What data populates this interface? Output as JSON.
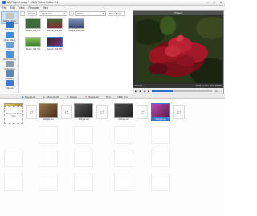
{
  "window": {
    "title": "MyProject.avspr* - AVS Video Editor 6.1",
    "minimize": "–",
    "maximize": "□",
    "close": "✕"
  },
  "menu": [
    "File",
    "Edit",
    "View",
    "Recorder",
    "Help"
  ],
  "sidebar": {
    "items": [
      {
        "label": "Media Library",
        "icon": "media-library-icon",
        "color": "#c4c4c4"
      },
      {
        "label": "Transitions",
        "icon": "transitions-icon",
        "color": "#2f73c4"
      },
      {
        "label": "Video Effects",
        "icon": "video-effects-icon",
        "color": "#3b8fd7"
      },
      {
        "label": "Text",
        "icon": "text-icon",
        "color": "#6a9fd9"
      },
      {
        "label": "Video Overlay",
        "icon": "video-overlay-icon",
        "color": "#4a90d8"
      },
      {
        "label": "Audio Mixer",
        "icon": "audio-mixer-icon",
        "color": "#8b9bb0"
      },
      {
        "label": "Chapters",
        "icon": "chapters-icon",
        "color": "#5d86b7"
      },
      {
        "label": "Produce",
        "icon": "produce-icon",
        "color": "#3a7ad2"
      }
    ]
  },
  "toolbar": {
    "import_label": "Import",
    "folder_value": "Clipboard",
    "filter_value": "Video",
    "save_label": "Save Movie..."
  },
  "library": {
    "items": [
      {
        "caption": "Sample_002_001",
        "color": "#3d6b3a"
      },
      {
        "caption": "Sample_002_002",
        "color": "#7b3b4a"
      },
      {
        "caption": "Sample_002_003",
        "color": "#4b5e8a"
      },
      {
        "caption": "Sample_002_004",
        "color": "#5a8a3a"
      },
      {
        "caption": "Sample_002_005",
        "color": "#6a2a5a"
      }
    ]
  },
  "preview": {
    "title": "Project",
    "status_left": "Paused",
    "status_right": "00:00:11.375 / 00:00:33.366",
    "progress": 0.35,
    "speed": "1x"
  },
  "edit_toolbar": {
    "items": [
      "Move Left",
      "Move Right",
      "Delete",
      "Delete all",
      "Trim",
      "Multi Trim"
    ]
  },
  "storyboard": {
    "drop_hint": "Drag media items here",
    "clips": [
      {
        "caption": "Sample.avi",
        "color": "#c9a93a"
      },
      {
        "caption": "Sample.avi",
        "color": "#6a4a2a"
      },
      {
        "caption": "Sample.avi",
        "color": "#3a3a3a"
      },
      {
        "caption": "Sample.avi",
        "color": "#2e2e2e"
      },
      {
        "caption": "Sample.avi",
        "color": "#7a2a3a"
      },
      {
        "caption": "Sample.avi",
        "color": "#9a3a8a"
      }
    ]
  }
}
